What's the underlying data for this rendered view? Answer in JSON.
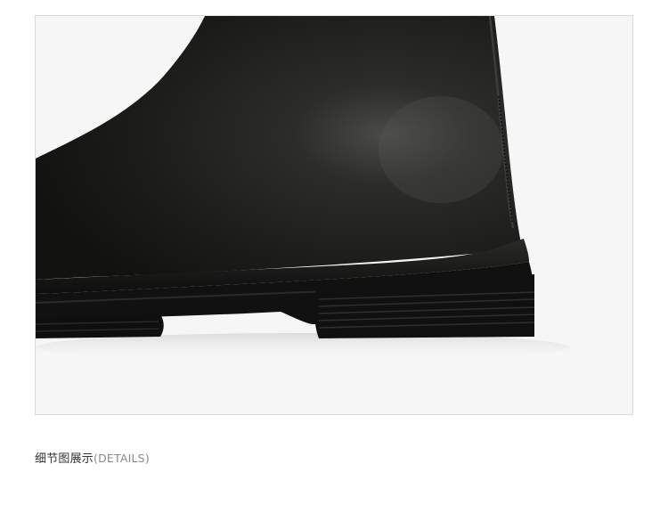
{
  "caption": {
    "title": "细节图展示",
    "subtitle": "(DETAILS)"
  },
  "colors": {
    "background": "#ffffff",
    "photo_background": "#f6f6f6",
    "frame_border": "#d9d9d9",
    "caption_text": "#333333",
    "caption_subtitle": "#8a8a8a",
    "leather": "#1c1d1b",
    "sole": "#111111"
  },
  "photo": {
    "subject": "boot-heel-detail"
  }
}
